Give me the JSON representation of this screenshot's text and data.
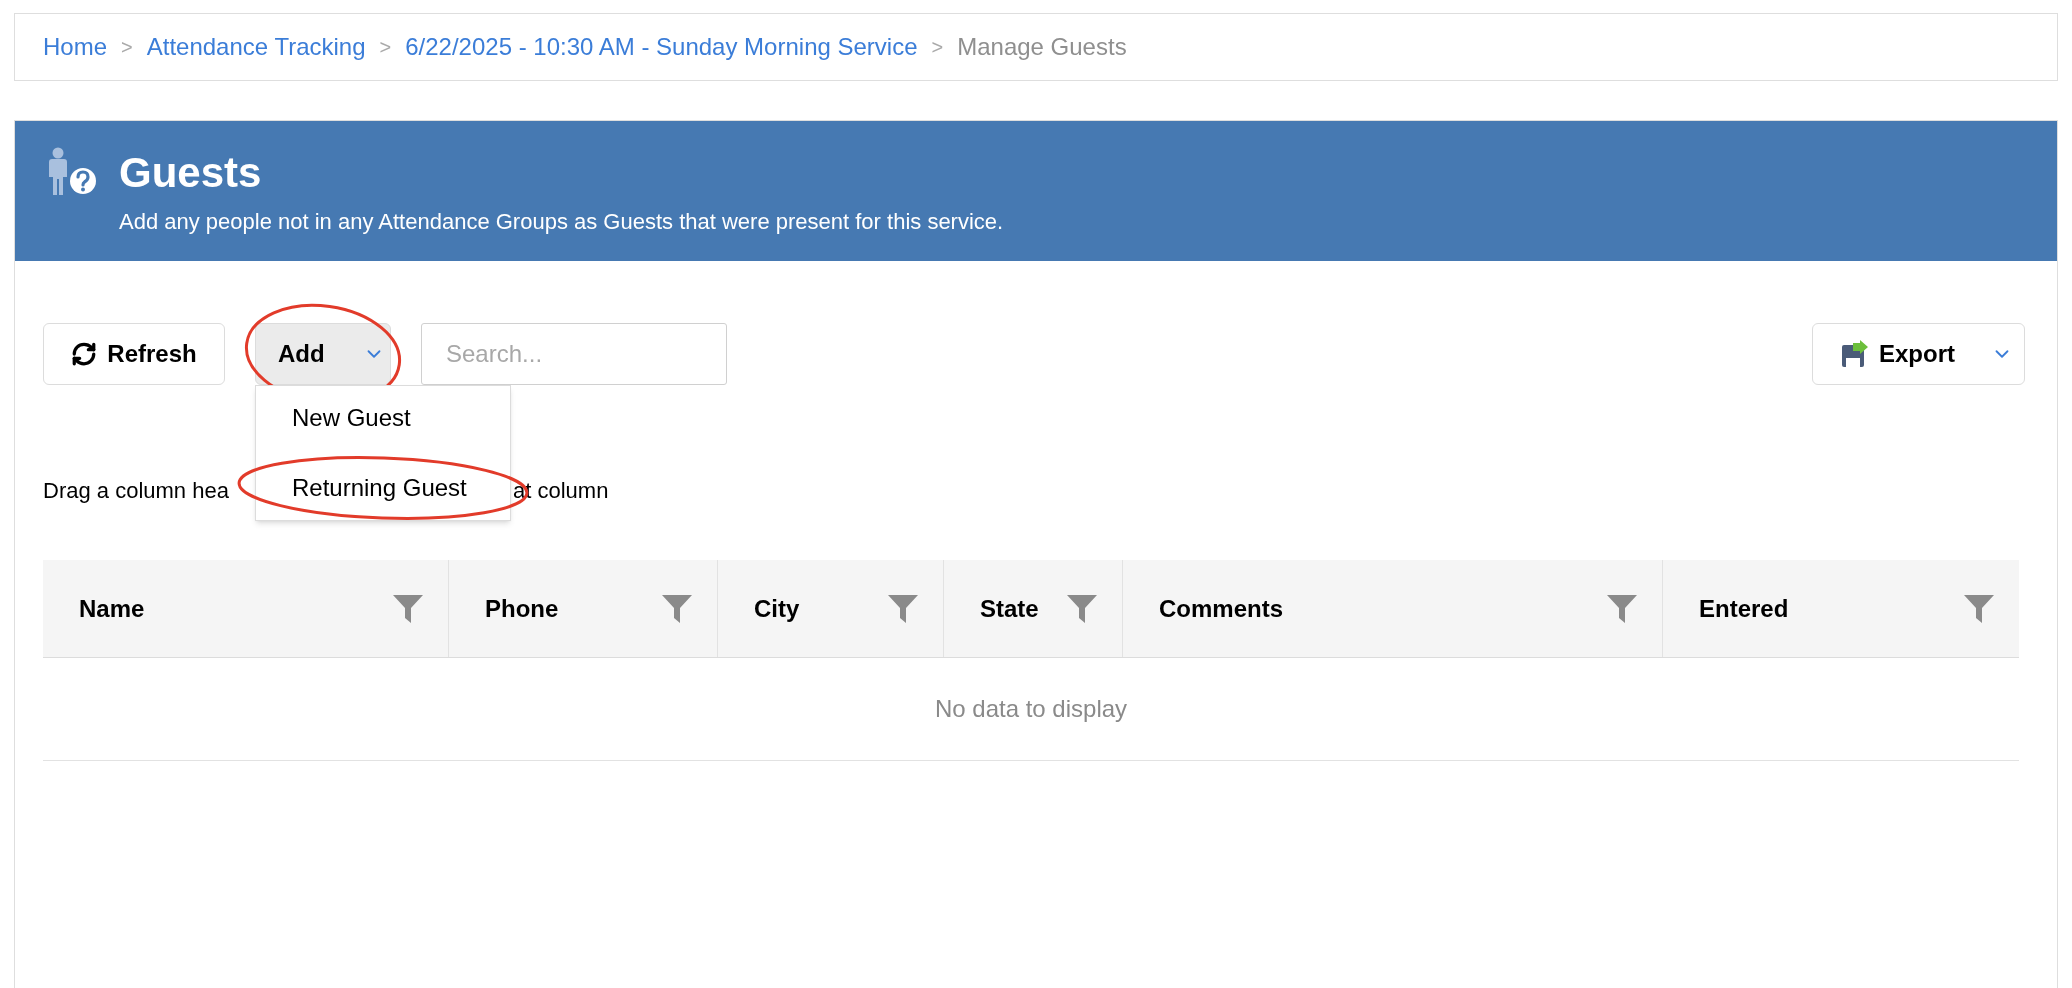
{
  "breadcrumb": [
    {
      "label": "Home",
      "current": false
    },
    {
      "separator": ">",
      "label": "Attendance Tracking",
      "current": false
    },
    {
      "separator": ">",
      "label": "6/22/2025 - 10:30 AM - Sunday Morning Service",
      "current": false
    },
    {
      "separator": ">",
      "label": "Manage Guests",
      "current": true
    }
  ],
  "header": {
    "title": "Guests",
    "subtitle": "Add any people not in any Attendance Groups as Guests that were present for this service."
  },
  "toolbar": {
    "refresh": {
      "label": "Refresh"
    },
    "add": {
      "label": "Add",
      "circled": true,
      "expanded": true
    },
    "search": {
      "placeholder": "Search..."
    },
    "export": {
      "label": "Export"
    }
  },
  "add_menu": [
    {
      "label": "New Guest",
      "circled": false
    },
    {
      "label": "Returning Guest",
      "circled": true
    }
  ],
  "group_hint": [
    "Drag a column hea",
    "at column"
  ],
  "table": {
    "columns": [
      "Name",
      "Phone",
      "City",
      "State",
      "Comments",
      "Entered"
    ],
    "empty_text": "No data to display"
  }
}
